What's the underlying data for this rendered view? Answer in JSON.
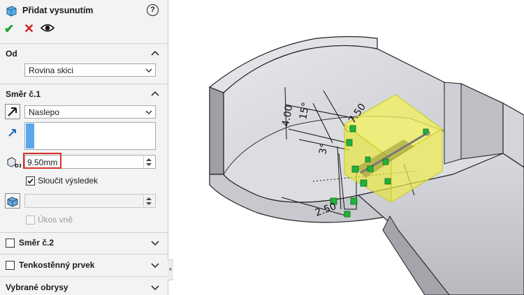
{
  "feature": {
    "title": "Přidat vysunutím",
    "help_icon": "?",
    "confirm_icon": "checkmark-icon",
    "cancel_icon": "close-icon",
    "preview_icon": "eye-icon"
  },
  "from_section": {
    "header": "Od",
    "start_condition": "Rovina skici"
  },
  "direction1": {
    "header": "Směr č.1",
    "end_condition": "Naslepo",
    "depth": "9.50mm",
    "merge_result_label": "Sloučit výsledek",
    "merge_result_checked": true,
    "draft_outward_label": "Úkos vně",
    "draft_outward_enabled": false
  },
  "direction2": {
    "header": "Směr č.2",
    "checked": false
  },
  "thin_feature": {
    "header": "Tenkostěnný prvek",
    "checked": false
  },
  "selected_contours": {
    "header": "Vybrané obrysy"
  },
  "viewport": {
    "dimensions": [
      "7.50",
      "4.00",
      "15°",
      "3°",
      "2.50"
    ]
  },
  "colors": {
    "accept": "#1a9e2e",
    "cancel": "#d41f1f",
    "highlight": "#d9302b",
    "preview_fill": "#f2f25a",
    "part_gray": "#c9cacf"
  }
}
